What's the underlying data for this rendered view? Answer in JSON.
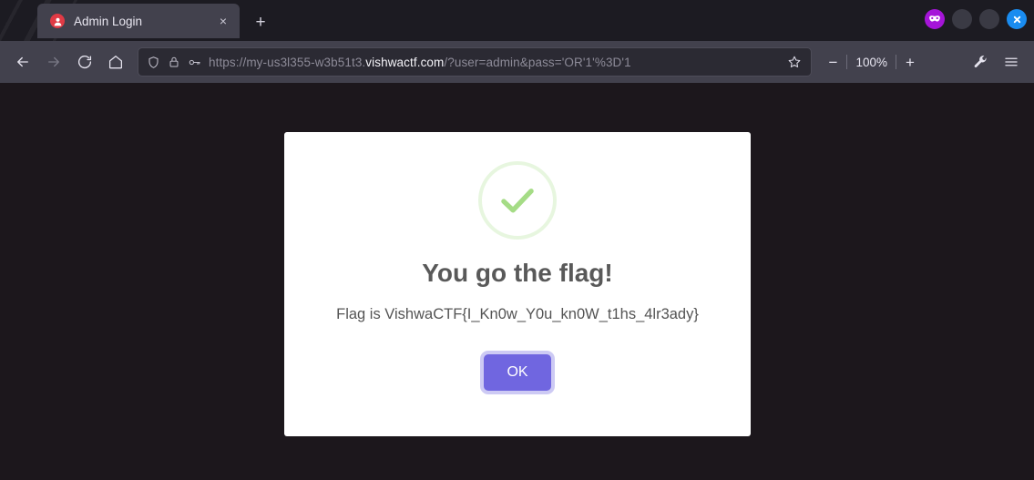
{
  "browser": {
    "tab": {
      "favicon": "user-circle-red-icon",
      "title": "Admin Login",
      "close_label": "×"
    },
    "new_tab_label": "+",
    "toolbar_icons": {
      "back": "back-arrow-icon",
      "forward": "forward-arrow-icon",
      "reload": "reload-icon",
      "home": "home-icon",
      "shield": "shield-icon",
      "lock": "padlock-icon",
      "permissions": "key-icon",
      "bookmark": "star-outline-icon",
      "devtools": "wrench-icon",
      "menu": "hamburger-menu-icon"
    },
    "extensions": [
      {
        "name": "mask-extension-icon",
        "color": "#a515d8"
      },
      {
        "name": "blank-extension-icon-1",
        "color": "#3a3a44"
      },
      {
        "name": "blank-extension-icon-2",
        "color": "#3a3a44"
      },
      {
        "name": "close-extension-icon",
        "color": "#1a8cf0"
      }
    ],
    "url": {
      "scheme_and_sub": "https://my-us3l355-w3b51t3.",
      "host": "vishwactf.com",
      "path_and_query": "/?user=admin&pass='OR'1'%3D'1"
    },
    "zoom": {
      "out_label": "−",
      "level": "100%",
      "in_label": "+"
    }
  },
  "dialog": {
    "icon": "success-check-icon",
    "title": "You go the flag!",
    "message": "Flag is VishwaCTF{I_Kn0w_Y0u_kn0W_t1hs_4lr3ady}",
    "confirm_label": "OK"
  },
  "colors": {
    "accent_button": "#7066e0",
    "success_green": "#a5dc86",
    "page_background": "#1c171c",
    "chrome_background": "#42414d",
    "tabstrip_background": "#1c1b22"
  }
}
